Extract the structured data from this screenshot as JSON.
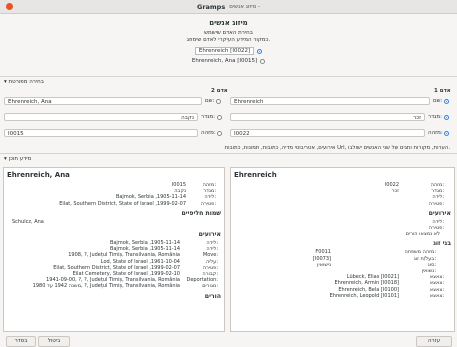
{
  "window": {
    "title": "Gramps",
    "subtitle": "מיזוג אנשים - "
  },
  "header": {
    "title": "מיזוג אנשים",
    "note1": "בחירת האדם שישמש",
    "note2": "כמקור המידע העיקרי לאדם שימוזג.",
    "choice1": "Ehrenreich [I0022]",
    "choice2": "Ehrenreich, Ana [I0015]"
  },
  "advanced": {
    "label": "בחירה מפורטת"
  },
  "person1": {
    "heading": "אדם 1",
    "name_label": "שם:",
    "name": "Ehrenreich",
    "gender_label": "מגדר:",
    "gender": "זכר",
    "id_label": "מזהה:",
    "id": "I0022"
  },
  "person2": {
    "heading": "אדם 2",
    "name_label": "שם:",
    "name": "Ehrenreich, Ana",
    "gender_label": "מגדר:",
    "gender": "נקבה",
    "id_label": "מזהה:",
    "id": "I0015"
  },
  "merge_note": "אירועים, אטריבוטי מדיה, כתובות, תמונות, כתובות Url, הערות, מקורות ותגים של שני האנשים ישולבו.",
  "context": {
    "label": "מידע תוכן"
  },
  "left_panel": {
    "name": "Ehrenreich, Ana",
    "rows": [
      {
        "k": "מזהה:",
        "v": "I0015"
      },
      {
        "k": "מגדר:",
        "v": "נקבה"
      },
      {
        "k": "לידה:",
        "v": "Bajmok, Serbia ,1905-11-14"
      },
      {
        "k": "פטירה:",
        "v": "Eilat, Southern District, State of Israel ,1999-02-07"
      }
    ],
    "alt_names_title": "שמות חליפיים",
    "alt_names": [
      "Schulcz, Ana"
    ],
    "events_title": "אירועים",
    "events": [
      {
        "k": "לידה:",
        "v": "Bajmok, Serbia ,1905-11-14"
      },
      {
        "k": "לידה:",
        "v": "Bajmok, Serbia ,1905-11-14"
      },
      {
        "k": "Move:",
        "v": "1908, ?, Județul Timiș, Transilvania, România"
      },
      {
        "k": "עליה:",
        "v": "Lod, State of Israel ,1961-10-04"
      },
      {
        "k": "פטירה:",
        "v": "Eilat, Southern District, State of Israel ,1999-02-07"
      },
      {
        "k": "קבורה:",
        "v": "Eilat Cemetery, State of Israel ,1999-02-10"
      },
      {
        "k": "Deportation:",
        "v": "1941-09-00, ?, ?, Județul Timiș, Transilvania, România"
      },
      {
        "k": "מגורים:",
        "v": "משנה 1942 עד 1980, ?, Județul Timiș, Transilvania, România"
      }
    ],
    "parents_title": "הורים"
  },
  "right_panel": {
    "name": "Ehrenreich",
    "rows": [
      {
        "k": "מזהה:",
        "v": "I0022"
      },
      {
        "k": "מגדר:",
        "v": "זכר"
      },
      {
        "k": "לידה:",
        "v": ""
      },
      {
        "k": "פטירה:",
        "v": ""
      }
    ],
    "events_title": "אירועים",
    "events": [
      {
        "k": "לידה:",
        "v": ""
      },
      {
        "k": "פטירה:",
        "v": ""
      }
    ],
    "parents_missing": "לא נמצאו הורים",
    "spouses_title": "בני זוג",
    "family_label": "מזהה משפחה:",
    "family_id": "F0011",
    "partner_label": "בעל/ת זוג:",
    "partner_id": "[I0073]",
    "type_label": "סוג:",
    "type": "נישואין",
    "married_label": "נשואין:",
    "children": [
      {
        "k": "צאצא:",
        "v": "Lübeck, Elias [I0021]"
      },
      {
        "k": "צאצא:",
        "v": "Ehrenreich, Armin [I0018]"
      },
      {
        "k": "צאצא:",
        "v": "Ehrenreich, Bela [I0100]"
      },
      {
        "k": "צאצא:",
        "v": "Ehrenreich, Leopold [I0101]"
      }
    ]
  },
  "buttons": {
    "help": "עזרה",
    "cancel": "ביטול",
    "ok": "בסדר"
  }
}
